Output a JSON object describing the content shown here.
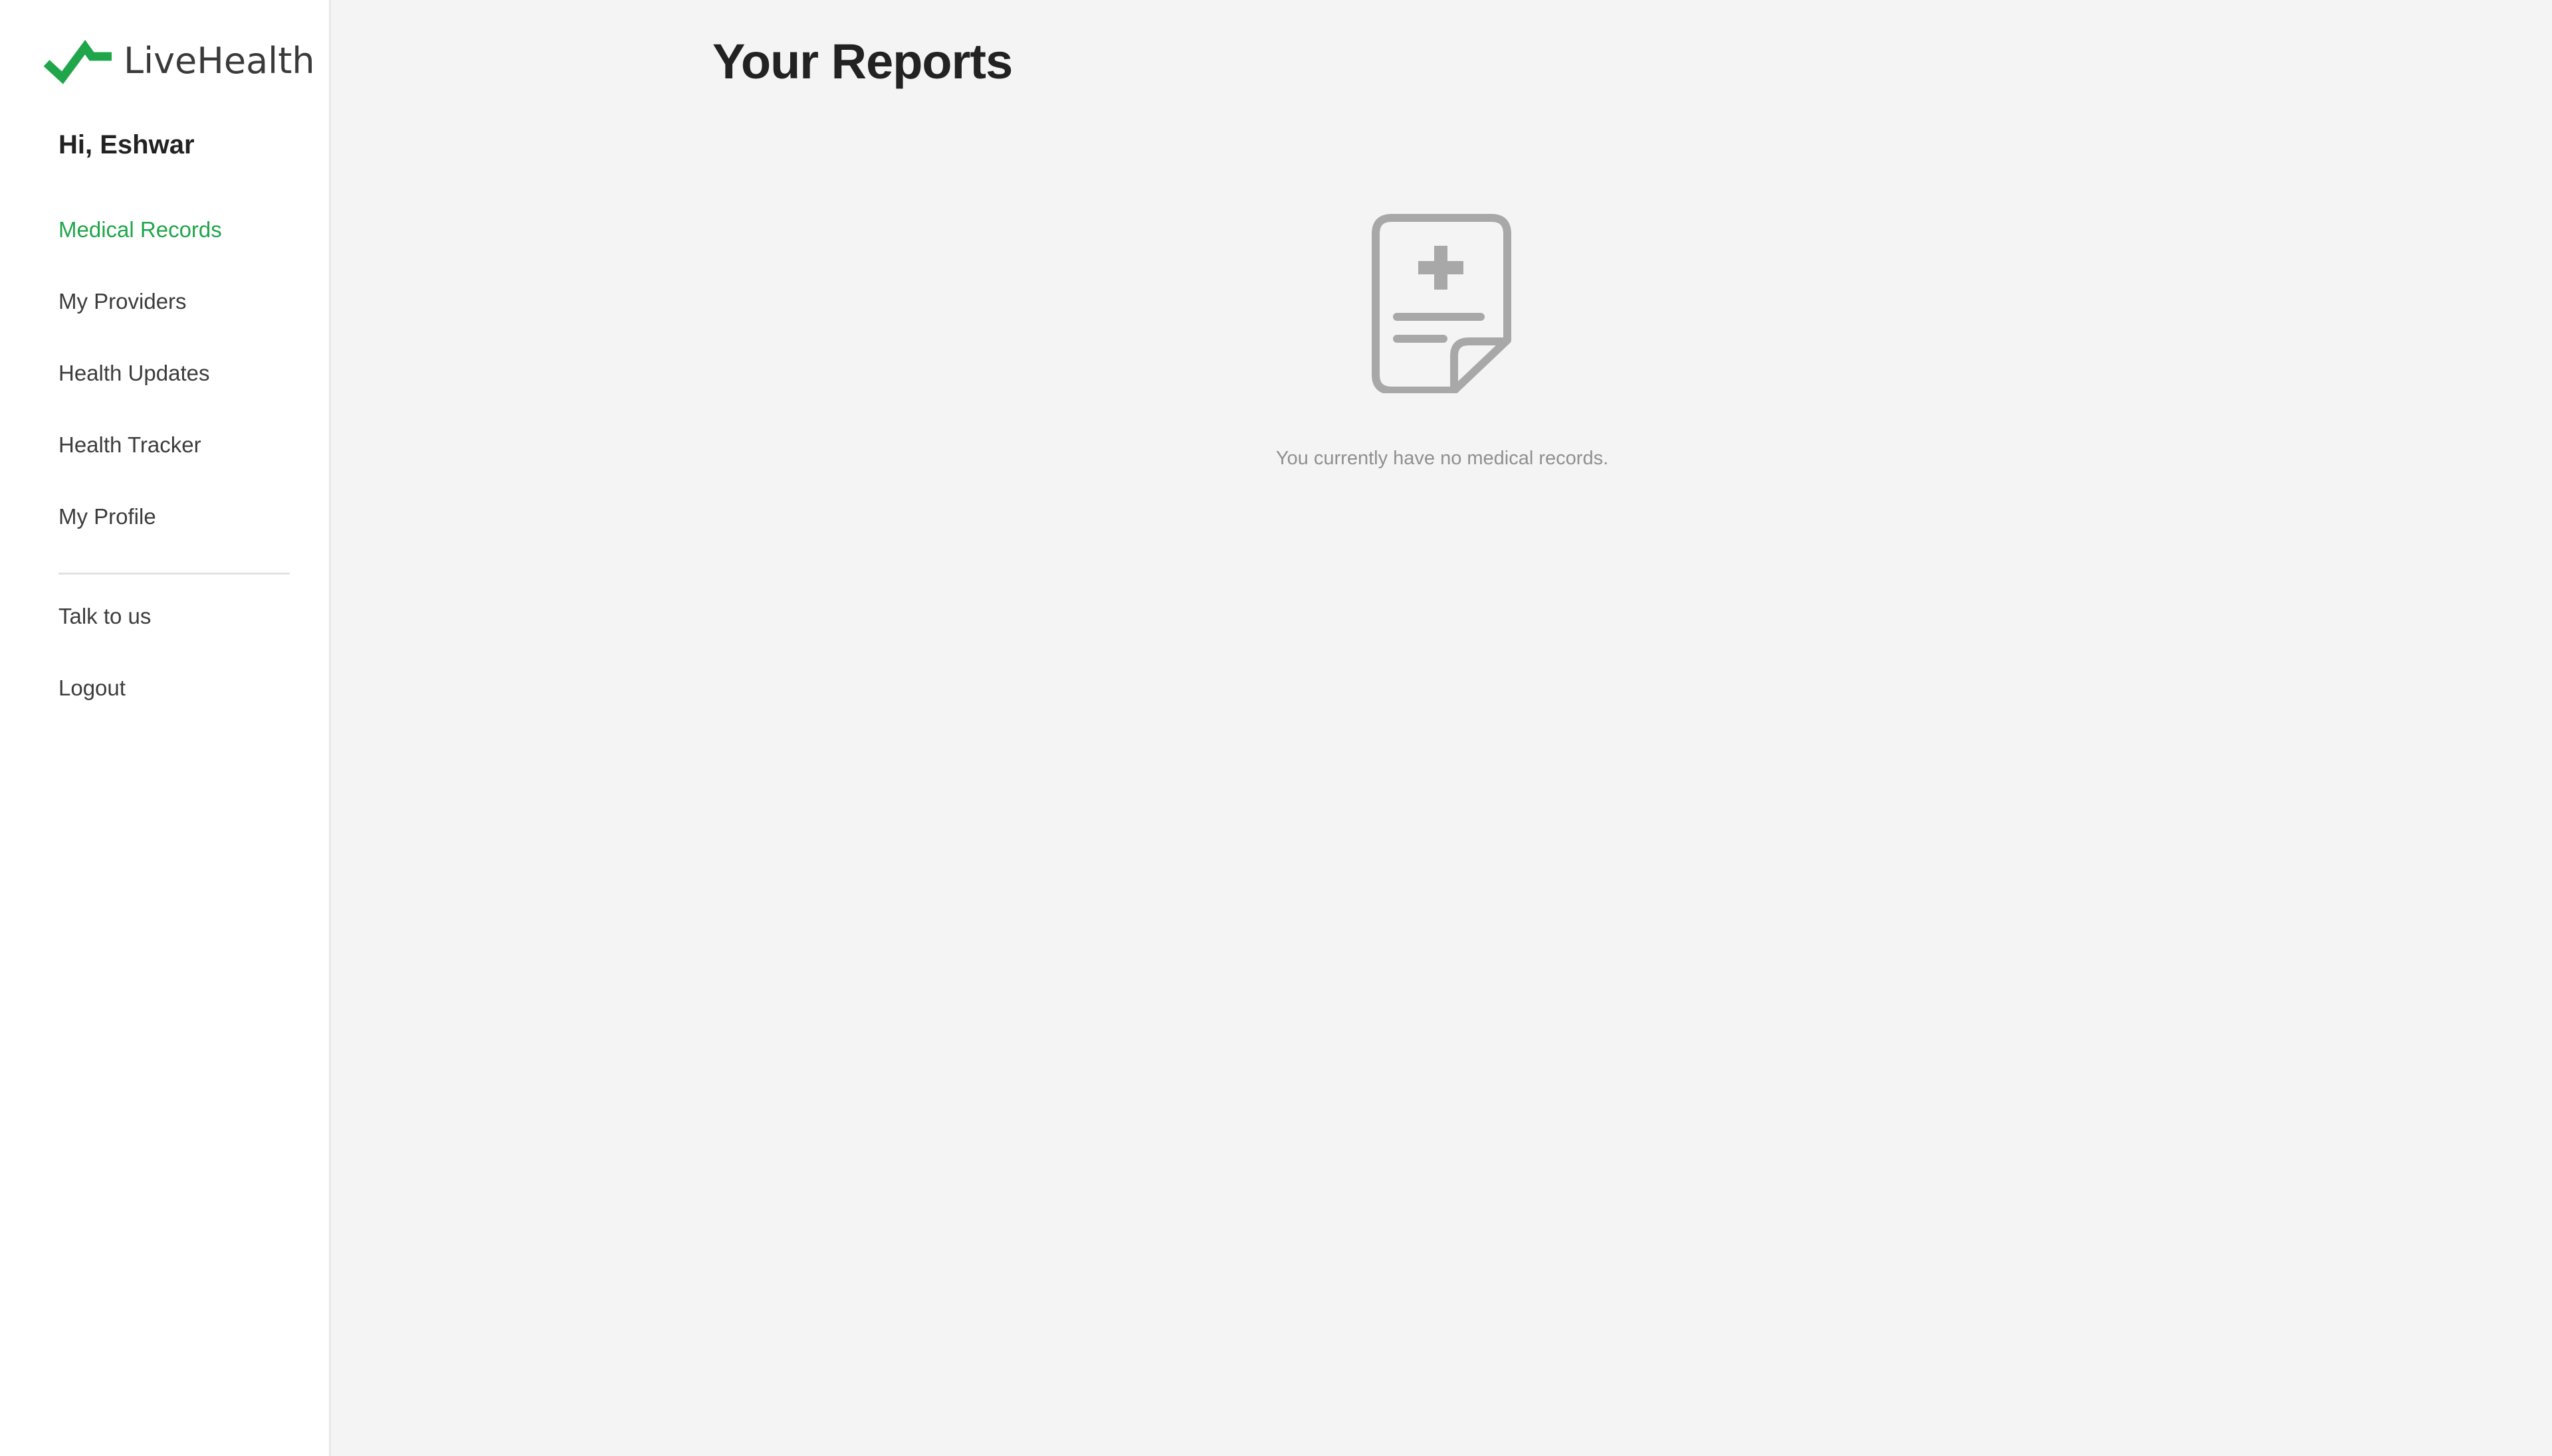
{
  "brand": {
    "name": "LiveHealth",
    "accent_color": "#1fa64a",
    "logo_icon": "check-mark-logo"
  },
  "sidebar": {
    "greeting": "Hi, Eshwar",
    "items": [
      {
        "label": "Medical Records",
        "active": true
      },
      {
        "label": "My Providers",
        "active": false
      },
      {
        "label": "Health Updates",
        "active": false
      },
      {
        "label": "Health Tracker",
        "active": false
      },
      {
        "label": "My Profile",
        "active": false
      }
    ],
    "secondary_items": [
      {
        "label": "Talk to us"
      },
      {
        "label": "Logout"
      }
    ]
  },
  "main": {
    "title": "Your Reports",
    "empty_state": {
      "icon": "medical-document-icon",
      "message": "You currently have no medical records."
    }
  }
}
